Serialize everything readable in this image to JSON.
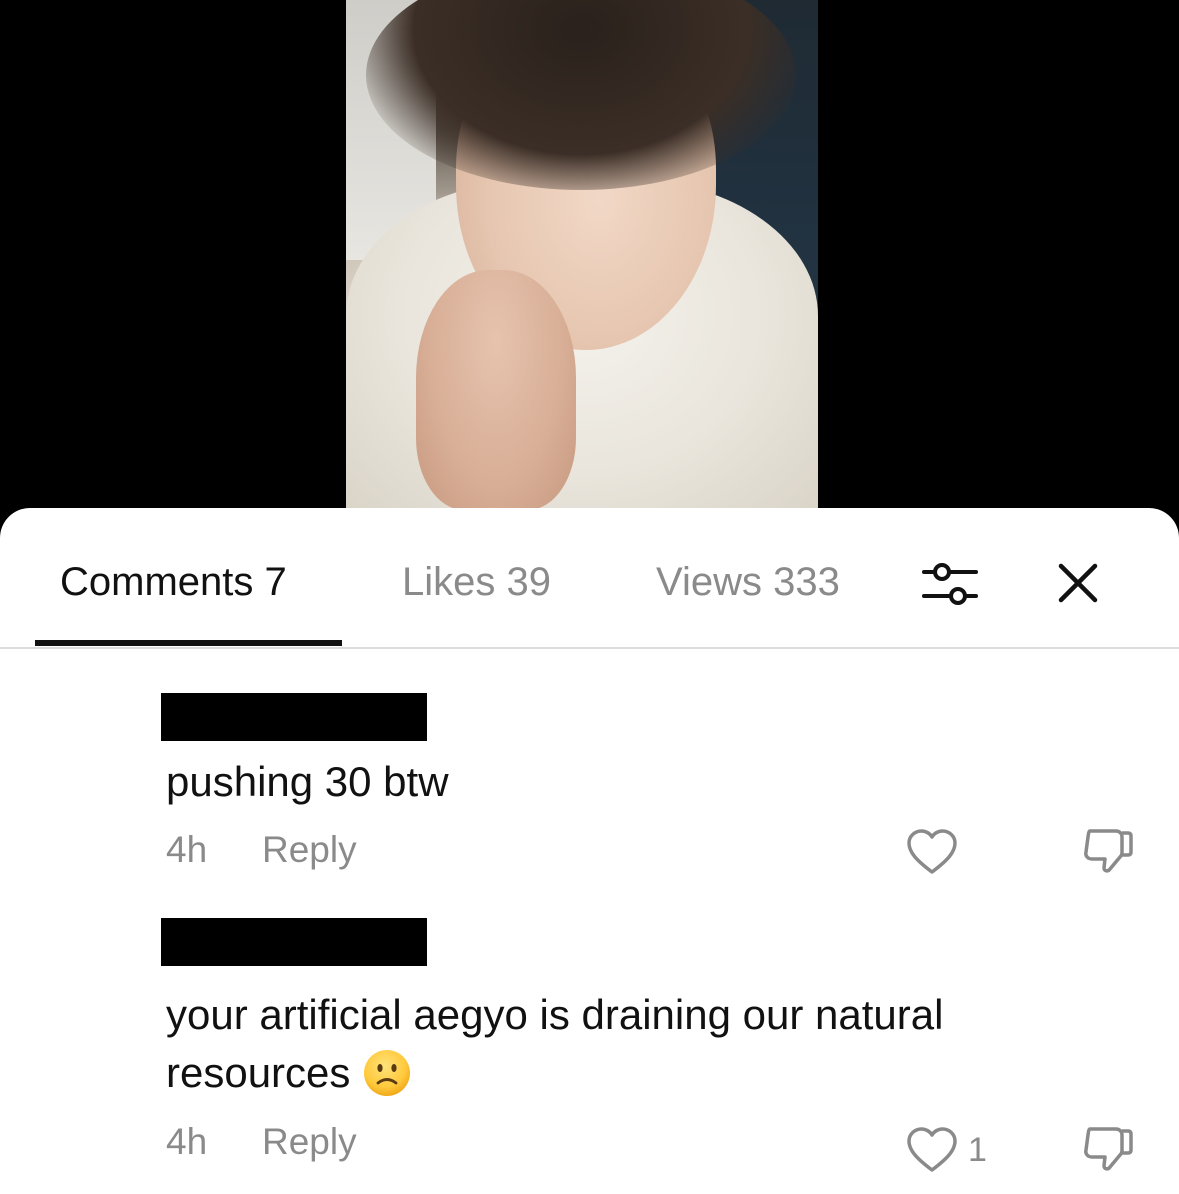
{
  "tabs": {
    "comments_label": "Comments 7",
    "likes_label": "Likes 39",
    "views_label": "Views 333"
  },
  "comments": [
    {
      "text": "pushing 30 btw",
      "time": "4h",
      "reply_label": "Reply",
      "like_count": ""
    },
    {
      "text": "your artificial aegyo is draining our natural resources",
      "time": "4h",
      "reply_label": "Reply",
      "like_count": "1",
      "emoji": "slightly-frowning-face"
    }
  ],
  "icons": {
    "filter": "sliders-icon",
    "close": "close-icon",
    "heart": "heart-outline-icon",
    "dislike": "thumbs-down-icon"
  },
  "colors": {
    "active_text": "#111111",
    "inactive_text": "#8a8a8a",
    "sheet_bg": "#ffffff",
    "divider": "#dcdcdc"
  }
}
